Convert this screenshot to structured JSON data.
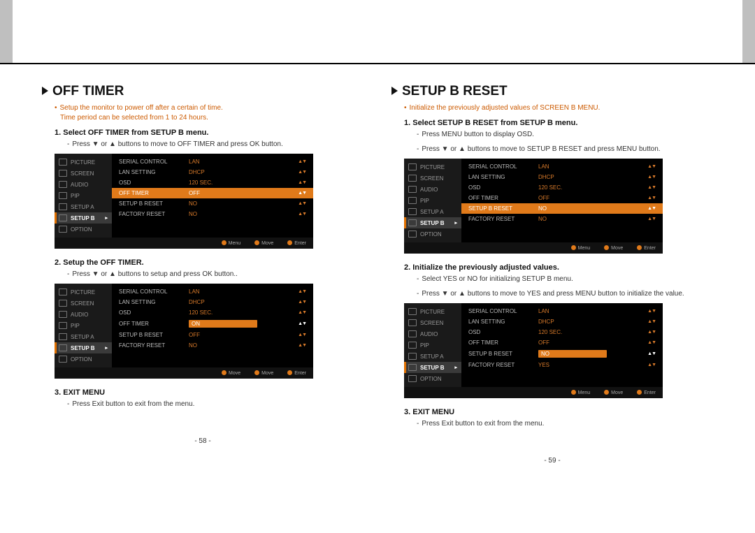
{
  "left": {
    "title": "OFF TIMER",
    "intro1": "Setup the monitor to power off after a certain of time.",
    "intro2": "Time period can be selected from 1 to 24 hours.",
    "step1": "1.    Select OFF TIMER from SETUP B menu.",
    "step1sub": "Press ▼ or ▲ buttons to move to OFF TIMER and press OK button.",
    "step2": "2.    Setup the OFF TIMER.",
    "step2sub": "Press ▼ or ▲ buttons to setup and press OK button..",
    "step3": "3.    EXIT MENU",
    "step3sub": "Press Exit button to exit from the menu.",
    "pagenum": "- 58 -",
    "osd1": {
      "menu": [
        "PICTURE",
        "SCREEN",
        "AUDIO",
        "PIP",
        "SETUP A",
        "SETUP B ▸",
        "OPTION"
      ],
      "selected": "SETUP B ▸",
      "rows": [
        {
          "lab": "SERIAL CONTROL",
          "val": "LAN"
        },
        {
          "lab": "LAN SETTING",
          "val": "DHCP"
        },
        {
          "lab": "OSD",
          "val": "120 SEC."
        },
        {
          "lab": "OFF TIMER",
          "val": "OFF",
          "hl": true
        },
        {
          "lab": "SETUP B RESET",
          "val": "NO"
        },
        {
          "lab": "FACTORY RESET",
          "val": "NO"
        }
      ],
      "foot": [
        "Menu",
        "Move",
        "Enter"
      ]
    },
    "osd2": {
      "menu": [
        "PICTURE",
        "SCREEN",
        "AUDIO",
        "PIP",
        "SETUP A",
        "SETUP B ▸",
        "OPTION"
      ],
      "selected": "SETUP B ▸",
      "rows": [
        {
          "lab": "SERIAL CONTROL",
          "val": "LAN"
        },
        {
          "lab": "LAN SETTING",
          "val": "DHCP"
        },
        {
          "lab": "OSD",
          "val": "120 SEC."
        },
        {
          "lab": "OFF TIMER",
          "val": "ON",
          "hl2": true
        },
        {
          "lab": "SETUP B RESET",
          "val": "OFF"
        },
        {
          "lab": "FACTORY RESET",
          "val": "NO"
        }
      ],
      "foot": [
        "Move",
        "Move",
        "Enter"
      ]
    }
  },
  "right": {
    "title": "SETUP B RESET",
    "intro1": "Initialize the previously adjusted values of SCREEN B MENU.",
    "step1": "1.    Select SETUP B RESET from SETUP B menu.",
    "step1sub1": "Press MENU button to display OSD.",
    "step1sub2": "Press ▼ or ▲ buttons to move to SETUP B RESET and press MENU button.",
    "step2": "2.    Initialize the previously adjusted values.",
    "step2sub1": "Select YES or NO for initializing SETUP B menu.",
    "step2sub2": "Press ▼ or ▲ buttons to move to YES and press MENU button to initialize the value.",
    "step3": "3.    EXIT MENU",
    "step3sub": "Press Exit button to exit from the menu.",
    "pagenum": "- 59 -",
    "osd1": {
      "menu": [
        "PICTURE",
        "SCREEN",
        "AUDIO",
        "PIP",
        "SETUP A",
        "SETUP B ▸",
        "OPTION"
      ],
      "selected": "SETUP B ▸",
      "rows": [
        {
          "lab": "SERIAL CONTROL",
          "val": "LAN"
        },
        {
          "lab": "LAN SETTING",
          "val": "DHCP"
        },
        {
          "lab": "OSD",
          "val": "120 SEC."
        },
        {
          "lab": "OFF TIMER",
          "val": "OFF"
        },
        {
          "lab": "SETUP B RESET",
          "val": "NO",
          "hl": true
        },
        {
          "lab": "FACTORY RESET",
          "val": "NO"
        }
      ],
      "foot": [
        "Menu",
        "Move",
        "Enter"
      ]
    },
    "osd2": {
      "menu": [
        "PICTURE",
        "SCREEN",
        "AUDIO",
        "PIP",
        "SETUP A",
        "SETUP B ▸",
        "OPTION"
      ],
      "selected": "SETUP B ▸",
      "rows": [
        {
          "lab": "SERIAL CONTROL",
          "val": "LAN"
        },
        {
          "lab": "LAN SETTING",
          "val": "DHCP"
        },
        {
          "lab": "OSD",
          "val": "120 SEC."
        },
        {
          "lab": "OFF TIMER",
          "val": "OFF"
        },
        {
          "lab": "SETUP B RESET",
          "val": "NO",
          "hl2": true
        },
        {
          "lab": "FACTORY RESET",
          "val": "YES"
        }
      ],
      "foot": [
        "Menu",
        "Move",
        "Enter"
      ]
    }
  }
}
